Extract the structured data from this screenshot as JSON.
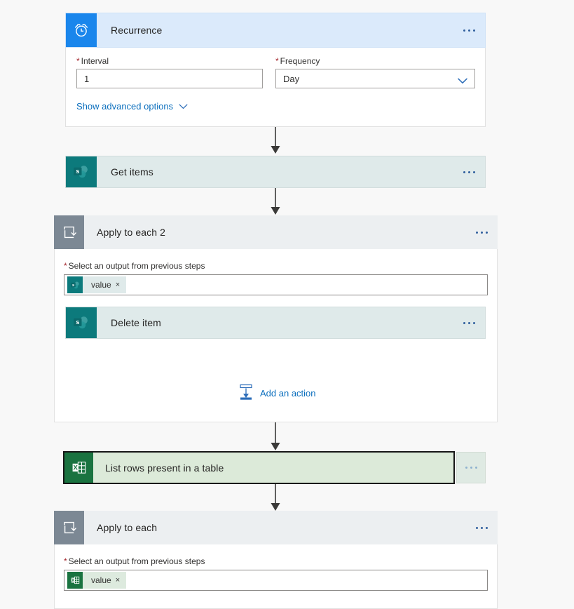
{
  "page": {
    "background": "#f8f8f8",
    "app": "Power Automate flow designer"
  },
  "colors": {
    "recurrence_header": "#dbeafb",
    "sharepoint_block": "#dfeaea",
    "loop_header": "#eceff1",
    "excel_selected": "#dcead9",
    "link": "#0a6ebd",
    "required_asterisk": "#a4262c",
    "sharepoint_icon": "#0c7a7c",
    "excel_icon": "#1a7340",
    "recurrence_icon": "#1a86ec",
    "loop_icon": "#7c8894"
  },
  "steps": {
    "recurrence": {
      "title": "Recurrence",
      "icon": "alarm-clock-icon",
      "menu": "...",
      "interval": {
        "label": "Interval",
        "required": true,
        "value": "1"
      },
      "frequency": {
        "label": "Frequency",
        "required": true,
        "value": "Day",
        "chevron": "chevron-down-icon"
      },
      "advanced_link": "Show advanced options"
    },
    "get_items": {
      "title": "Get items",
      "icon": "sharepoint-icon",
      "menu": "..."
    },
    "apply_to_each_2": {
      "title": "Apply to each 2",
      "icon": "loop-icon",
      "menu": "...",
      "output_label": "Select an output from previous steps",
      "output_required": true,
      "token": {
        "label": "value",
        "icon": "sharepoint-icon",
        "remove": "×"
      },
      "nested_step": {
        "title": "Delete item",
        "icon": "sharepoint-icon",
        "menu": "..."
      },
      "add_action": {
        "label": "Add an action",
        "icon": "insert-step-icon"
      }
    },
    "list_rows": {
      "title": "List rows present in a table",
      "icon": "excel-icon",
      "menu": "...",
      "selected": true
    },
    "apply_to_each": {
      "title": "Apply to each",
      "icon": "loop-icon",
      "menu": "...",
      "output_label": "Select an output from previous steps",
      "output_required": true,
      "token": {
        "label": "value",
        "icon": "excel-icon",
        "remove": "×"
      }
    }
  }
}
